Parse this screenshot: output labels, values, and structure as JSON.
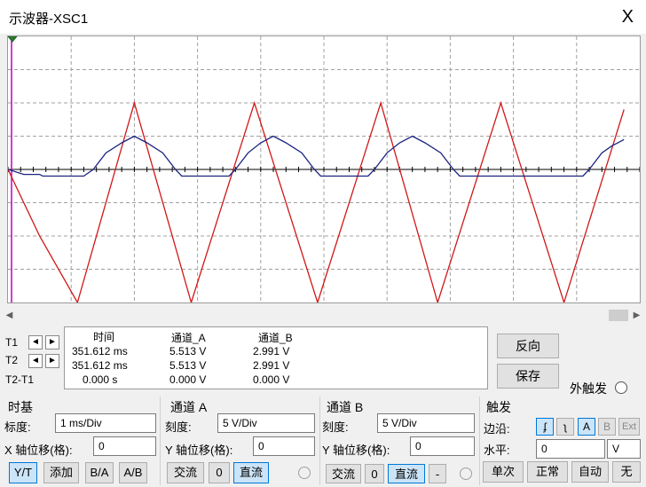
{
  "window": {
    "title": "示波器-XSC1",
    "close_label": "X"
  },
  "cursors": {
    "t1_label": "T1",
    "t2_label": "T2",
    "t2t1_label": "T2-T1",
    "left_arrow": "◄",
    "right_arrow": "►"
  },
  "readout": {
    "headers": [
      "时间",
      "通道_A",
      "通道_B"
    ],
    "rows": [
      [
        "351.612 ms",
        "5.513 V",
        "2.991 V"
      ],
      [
        "351.612 ms",
        "5.513 V",
        "2.991 V"
      ],
      [
        "0.000 s",
        "0.000 V",
        "0.000 V"
      ]
    ]
  },
  "actions": {
    "reverse_label": "反向",
    "save_label": "保存",
    "ext_trigger_label": "外触发"
  },
  "timebase": {
    "title": "时基",
    "scale_label": "标度:",
    "scale_value": "1 ms/Div",
    "xpos_label": "X 轴位移(格):",
    "xpos_value": "0",
    "yt_label": "Y/T",
    "add_label": "添加",
    "ba_label": "B/A",
    "ab_label": "A/B"
  },
  "channel_a": {
    "title": "通道 A",
    "scale_label": "刻度:",
    "scale_value": "5  V/Div",
    "ypos_label": "Y 轴位移(格):",
    "ypos_value": "0",
    "ac_label": "交流",
    "zero_label": "0",
    "dc_label": "直流"
  },
  "channel_b": {
    "title": "通道 B",
    "scale_label": "刻度:",
    "scale_value": "5  V/Div",
    "ypos_label": "Y 轴位移(格):",
    "ypos_value": "0",
    "ac_label": "交流",
    "zero_label": "0",
    "dc_label": "直流",
    "minus_label": "-"
  },
  "trigger": {
    "title": "触发",
    "edge_label": "边沿:",
    "level_label": "水平:",
    "level_value": "0",
    "level_unit": "V",
    "src_a": "A",
    "src_b": "B",
    "src_ext": "Ext",
    "single_label": "单次",
    "normal_label": "正常",
    "auto_label": "自动",
    "none_label": "无"
  },
  "colors": {
    "channel_a": "#d01818",
    "channel_b": "#1a237e",
    "cursor": "#c000c0",
    "grid": "#a0a0a0"
  },
  "chart_data": {
    "type": "line",
    "xlabel": "",
    "ylabel": "",
    "x_divisions": 10,
    "y_divisions": 8,
    "x_per_div": "1 ms/Div",
    "y_per_div": "5 V/Div",
    "xlim": [
      0,
      10
    ],
    "ylim": [
      -4,
      4
    ],
    "grid": true,
    "series": [
      {
        "channel": "A",
        "color": "#d01818",
        "points": [
          [
            0,
            0
          ],
          [
            0.5,
            -2
          ],
          [
            1.1,
            -4
          ],
          [
            2.0,
            2
          ],
          [
            2.9,
            -4
          ],
          [
            3.9,
            2
          ],
          [
            4.9,
            -4
          ],
          [
            5.9,
            2
          ],
          [
            6.8,
            -4
          ],
          [
            7.8,
            2
          ],
          [
            8.8,
            -4
          ],
          [
            9.75,
            1.8
          ]
        ]
      },
      {
        "channel": "B",
        "color": "#1a237e",
        "points": [
          [
            0,
            0
          ],
          [
            0.25,
            -0.15
          ],
          [
            0.35,
            -0.15
          ],
          [
            0.5,
            -0.15
          ],
          [
            0.55,
            -0.2
          ],
          [
            1.2,
            -0.2
          ],
          [
            1.35,
            0
          ],
          [
            1.55,
            0.5
          ],
          [
            1.8,
            0.8
          ],
          [
            2.0,
            1.0
          ],
          [
            2.2,
            0.8
          ],
          [
            2.45,
            0.5
          ],
          [
            2.65,
            0
          ],
          [
            2.75,
            -0.2
          ],
          [
            3.5,
            -0.2
          ],
          [
            3.6,
            0
          ],
          [
            3.8,
            0.5
          ],
          [
            4.0,
            0.8
          ],
          [
            4.2,
            1.0
          ],
          [
            4.4,
            0.8
          ],
          [
            4.65,
            0.5
          ],
          [
            4.85,
            0
          ],
          [
            4.95,
            -0.2
          ],
          [
            5.7,
            -0.2
          ],
          [
            5.8,
            0
          ],
          [
            6.0,
            0.5
          ],
          [
            6.2,
            0.8
          ],
          [
            6.4,
            1.0
          ],
          [
            6.6,
            0.8
          ],
          [
            6.85,
            0.5
          ],
          [
            7.05,
            0
          ],
          [
            7.15,
            -0.2
          ],
          [
            9.1,
            -0.2
          ],
          [
            9.2,
            0
          ],
          [
            9.4,
            0.5
          ],
          [
            9.55,
            0.7
          ],
          [
            9.75,
            0.9
          ]
        ]
      }
    ]
  }
}
